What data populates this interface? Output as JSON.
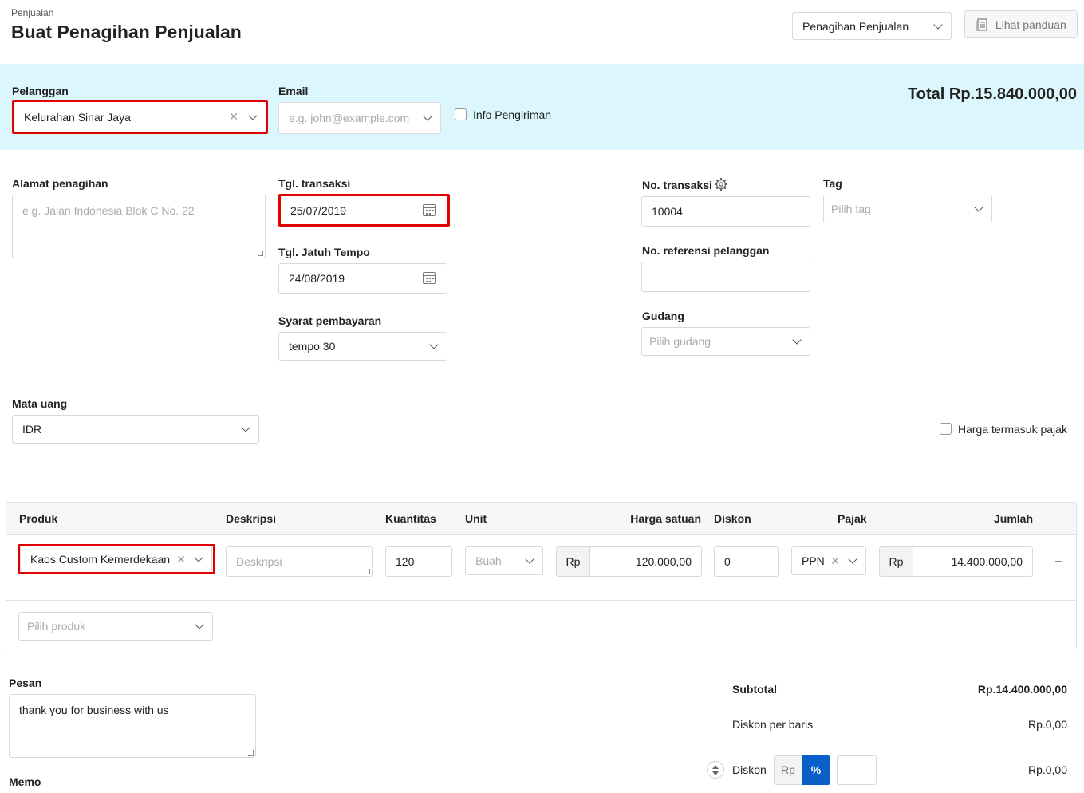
{
  "header": {
    "breadcrumb": "Penjualan",
    "title": "Buat Penagihan Penjualan",
    "type_select": "Penagihan Penjualan",
    "guide_button": "Lihat panduan"
  },
  "customer_bar": {
    "customer_label": "Pelanggan",
    "customer_value": "Kelurahan Sinar Jaya",
    "email_label": "Email",
    "email_placeholder": "e.g. john@example.com",
    "shipping_info_label": "Info Pengiriman",
    "total": "Total Rp.15.840.000,00"
  },
  "form": {
    "billing_address_label": "Alamat penagihan",
    "billing_address_placeholder": "e.g. Jalan Indonesia Blok C No. 22",
    "transaction_date_label": "Tgl. transaksi",
    "transaction_date": "25/07/2019",
    "due_date_label": "Tgl. Jatuh Tempo",
    "due_date": "24/08/2019",
    "payment_terms_label": "Syarat pembayaran",
    "payment_terms": "tempo 30",
    "transaction_no_label": "No. transaksi",
    "transaction_no": "10004",
    "customer_ref_label": "No. referensi pelanggan",
    "customer_ref": "",
    "warehouse_label": "Gudang",
    "warehouse_placeholder": "Pilih gudang",
    "tag_label": "Tag",
    "tag_placeholder": "Pilih tag",
    "currency_label": "Mata uang",
    "currency": "IDR",
    "tax_inclusive_label": "Harga termasuk pajak"
  },
  "table": {
    "headers": {
      "product": "Produk",
      "description": "Deskripsi",
      "quantity": "Kuantitas",
      "unit": "Unit",
      "unit_price": "Harga satuan",
      "discount": "Diskon",
      "tax": "Pajak",
      "amount": "Jumlah"
    },
    "row": {
      "product": "Kaos Custom Kemerdekaan",
      "description_placeholder": "Deskripsi",
      "quantity": "120",
      "unit": "Buah",
      "currency_prefix": "Rp",
      "unit_price": "120.000,00",
      "discount": "0",
      "tax": "PPN",
      "amount": "14.400.000,00",
      "remove": "–"
    },
    "add_product_placeholder": "Pilih produk"
  },
  "footer": {
    "message_label": "Pesan",
    "message": "thank you  for business with us",
    "memo_label": "Memo",
    "subtotal_label": "Subtotal",
    "subtotal": "Rp.14.400.000,00",
    "line_discount_label": "Diskon per baris",
    "line_discount": "Rp.0,00",
    "discount_label": "Diskon",
    "discount_rp": "Rp",
    "discount_pct": "%",
    "discount": "Rp.0,00"
  },
  "colors": {
    "customer_bar_bg": "#dbf6fd",
    "highlight": "#e00000",
    "primary": "#0a5ec7"
  }
}
